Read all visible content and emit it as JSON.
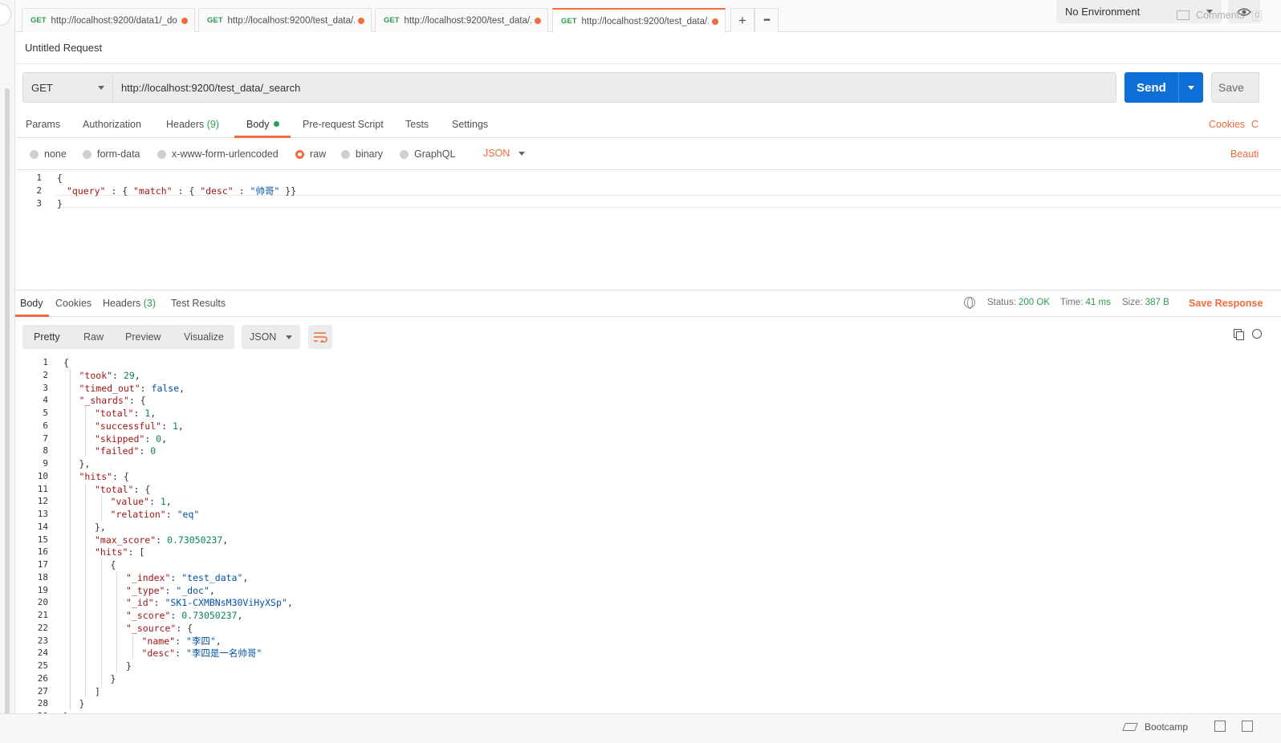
{
  "tabs": [
    {
      "method": "GET",
      "url": "http://localhost:9200/data1/_do..."
    },
    {
      "method": "GET",
      "url": "http://localhost:9200/test_data/..."
    },
    {
      "method": "GET",
      "url": "http://localhost:9200/test_data/..."
    },
    {
      "method": "GET",
      "url": "http://localhost:9200/test_data/..."
    }
  ],
  "tabbar": {
    "add_label": "+",
    "more_label": "•••"
  },
  "environment": {
    "selected": "No Environment"
  },
  "request": {
    "title": "Untitled Request",
    "comments_label": "Comments",
    "comments_count": "0",
    "method": "GET",
    "url": "http://localhost:9200/test_data/_search",
    "send_label": "Send",
    "save_label": "Save"
  },
  "request_tabs": {
    "params": "Params",
    "authorization": "Authorization",
    "headers": "Headers",
    "headers_count": "(9)",
    "body": "Body",
    "prerequest": "Pre-request Script",
    "tests": "Tests",
    "settings": "Settings",
    "cookies": "Cookies",
    "code": "C"
  },
  "body_types": {
    "none": "none",
    "form_data": "form-data",
    "urlencoded": "x-www-form-urlencoded",
    "raw": "raw",
    "binary": "binary",
    "graphql": "GraphQL",
    "format": "JSON",
    "beautify": "Beauti"
  },
  "request_body": {
    "line_numbers": [
      "1",
      "2",
      "3"
    ],
    "l1": "{",
    "l2": {
      "k1": "\"query\"",
      "p1": " : { ",
      "k2": "\"match\"",
      "p2": " : { ",
      "k3": "\"desc\"",
      "p3": " : ",
      "s1": "\"帅哥\"",
      "p4": " }}"
    },
    "l3": "}"
  },
  "response_tabs": {
    "body": "Body",
    "cookies": "Cookies",
    "headers": "Headers",
    "headers_count": "(3)",
    "test_results": "Test Results"
  },
  "response_status": {
    "status_label": "Status:",
    "status_value": "200 OK",
    "time_label": "Time:",
    "time_value": "41 ms",
    "size_label": "Size:",
    "size_value": "387 B",
    "save_response": "Save Response"
  },
  "response_view": {
    "pretty": "Pretty",
    "raw": "Raw",
    "preview": "Preview",
    "visualize": "Visualize",
    "format": "JSON"
  },
  "response_body": {
    "lines": [
      [
        [
          "p",
          "{"
        ]
      ],
      [
        [
          "k",
          "\"took\""
        ],
        [
          "p",
          ": "
        ],
        [
          "n",
          "29"
        ],
        [
          "p",
          ","
        ]
      ],
      [
        [
          "k",
          "\"timed_out\""
        ],
        [
          "p",
          ": "
        ],
        [
          "b",
          "false"
        ],
        [
          "p",
          ","
        ]
      ],
      [
        [
          "k",
          "\"_shards\""
        ],
        [
          "p",
          ": {"
        ]
      ],
      [
        [
          "k",
          "\"total\""
        ],
        [
          "p",
          ": "
        ],
        [
          "n",
          "1"
        ],
        [
          "p",
          ","
        ]
      ],
      [
        [
          "k",
          "\"successful\""
        ],
        [
          "p",
          ": "
        ],
        [
          "n",
          "1"
        ],
        [
          "p",
          ","
        ]
      ],
      [
        [
          "k",
          "\"skipped\""
        ],
        [
          "p",
          ": "
        ],
        [
          "n",
          "0"
        ],
        [
          "p",
          ","
        ]
      ],
      [
        [
          "k",
          "\"failed\""
        ],
        [
          "p",
          ": "
        ],
        [
          "n",
          "0"
        ]
      ],
      [
        [
          "p",
          "},"
        ]
      ],
      [
        [
          "k",
          "\"hits\""
        ],
        [
          "p",
          ": {"
        ]
      ],
      [
        [
          "k",
          "\"total\""
        ],
        [
          "p",
          ": {"
        ]
      ],
      [
        [
          "k",
          "\"value\""
        ],
        [
          "p",
          ": "
        ],
        [
          "n",
          "1"
        ],
        [
          "p",
          ","
        ]
      ],
      [
        [
          "k",
          "\"relation\""
        ],
        [
          "p",
          ": "
        ],
        [
          "s",
          "\"eq\""
        ]
      ],
      [
        [
          "p",
          "},"
        ]
      ],
      [
        [
          "k",
          "\"max_score\""
        ],
        [
          "p",
          ": "
        ],
        [
          "n",
          "0.73050237"
        ],
        [
          "p",
          ","
        ]
      ],
      [
        [
          "k",
          "\"hits\""
        ],
        [
          "p",
          ": ["
        ]
      ],
      [
        [
          "p",
          "{"
        ]
      ],
      [
        [
          "k",
          "\"_index\""
        ],
        [
          "p",
          ": "
        ],
        [
          "s",
          "\"test_data\""
        ],
        [
          "p",
          ","
        ]
      ],
      [
        [
          "k",
          "\"_type\""
        ],
        [
          "p",
          ": "
        ],
        [
          "s",
          "\"_doc\""
        ],
        [
          "p",
          ","
        ]
      ],
      [
        [
          "k",
          "\"_id\""
        ],
        [
          "p",
          ": "
        ],
        [
          "s",
          "\"SK1-CXMBNsM30ViHyXSp\""
        ],
        [
          "p",
          ","
        ]
      ],
      [
        [
          "k",
          "\"_score\""
        ],
        [
          "p",
          ": "
        ],
        [
          "n",
          "0.73050237"
        ],
        [
          "p",
          ","
        ]
      ],
      [
        [
          "k",
          "\"_source\""
        ],
        [
          "p",
          ": {"
        ]
      ],
      [
        [
          "k",
          "\"name\""
        ],
        [
          "p",
          ": "
        ],
        [
          "s",
          "\"李四\""
        ],
        [
          "p",
          ","
        ]
      ],
      [
        [
          "k",
          "\"desc\""
        ],
        [
          "p",
          ": "
        ],
        [
          "s",
          "\"李四是一名帅哥\""
        ]
      ],
      [
        [
          "p",
          "}"
        ]
      ],
      [
        [
          "p",
          "}"
        ]
      ],
      [
        [
          "p",
          "]"
        ]
      ],
      [
        [
          "p",
          "}"
        ]
      ],
      [
        [
          "p",
          "}"
        ]
      ]
    ],
    "indents": [
      0,
      1,
      1,
      1,
      2,
      2,
      2,
      2,
      1,
      1,
      2,
      3,
      3,
      2,
      2,
      2,
      3,
      4,
      4,
      4,
      4,
      4,
      5,
      5,
      4,
      3,
      2,
      1,
      0
    ]
  },
  "footer": {
    "bootcamp": "Bootcamp"
  },
  "colors": {
    "accent": "#f26b3a",
    "send": "#0e6fd6",
    "status_green": "#2a9d4f"
  }
}
